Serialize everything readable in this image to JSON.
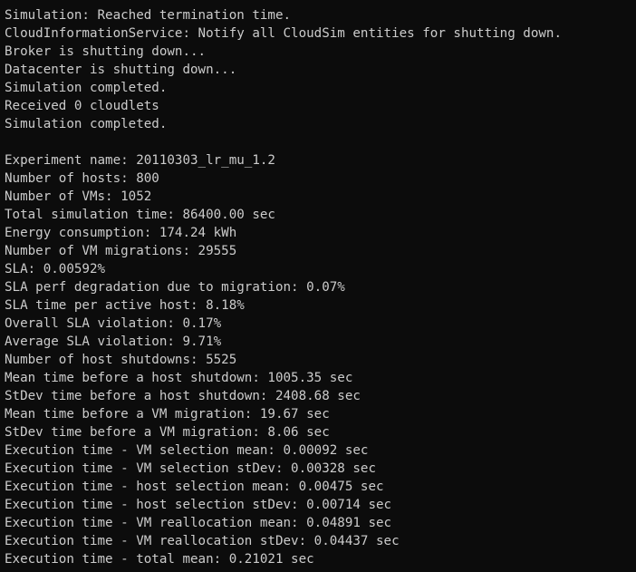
{
  "console": {
    "lines": [
      "Simulation: Reached termination time.",
      "CloudInformationService: Notify all CloudSim entities for shutting down.",
      "Broker is shutting down...",
      "Datacenter is shutting down...",
      "Simulation completed.",
      "Received 0 cloudlets",
      "Simulation completed.",
      "",
      "Experiment name: 20110303_lr_mu_1.2",
      "Number of hosts: 800",
      "Number of VMs: 1052",
      "Total simulation time: 86400.00 sec",
      "Energy consumption: 174.24 kWh",
      "Number of VM migrations: 29555",
      "SLA: 0.00592%",
      "SLA perf degradation due to migration: 0.07%",
      "SLA time per active host: 8.18%",
      "Overall SLA violation: 0.17%",
      "Average SLA violation: 9.71%",
      "Number of host shutdowns: 5525",
      "Mean time before a host shutdown: 1005.35 sec",
      "StDev time before a host shutdown: 2408.68 sec",
      "Mean time before a VM migration: 19.67 sec",
      "StDev time before a VM migration: 8.06 sec",
      "Execution time - VM selection mean: 0.00092 sec",
      "Execution time - VM selection stDev: 0.00328 sec",
      "Execution time - host selection mean: 0.00475 sec",
      "Execution time - host selection stDev: 0.00714 sec",
      "Execution time - VM reallocation mean: 0.04891 sec",
      "Execution time - VM reallocation stDev: 0.04437 sec",
      "Execution time - total mean: 0.21021 sec"
    ]
  },
  "colors": {
    "background": "#0c0c0c",
    "text": "#cccccc"
  }
}
